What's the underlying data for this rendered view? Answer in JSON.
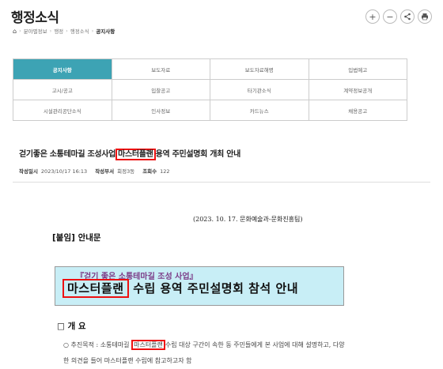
{
  "header": {
    "title": "행정소식"
  },
  "toolbar": {
    "zoom_in_label": "+",
    "zoom_out_label": "−"
  },
  "breadcrumb": {
    "items": [
      "분야별정보",
      "행정",
      "행정소식"
    ],
    "current": "공지사항"
  },
  "tabs": [
    {
      "label": "공지사항",
      "active": true
    },
    {
      "label": "보도자료",
      "active": false
    },
    {
      "label": "보도자료해명",
      "active": false
    },
    {
      "label": "입법예고",
      "active": false
    },
    {
      "label": "고시/공고",
      "active": false
    },
    {
      "label": "입찰공고",
      "active": false
    },
    {
      "label": "타기관소식",
      "active": false
    },
    {
      "label": "계약정보공개",
      "active": false
    },
    {
      "label": "시설관리공단소식",
      "active": false
    },
    {
      "label": "인사정보",
      "active": false
    },
    {
      "label": "카드뉴스",
      "active": false
    },
    {
      "label": "채용공고",
      "active": false
    }
  ],
  "post": {
    "title_pre": "걷기좋은 소통테마길 조성사업",
    "title_hl": "마스터플랜",
    "title_post": "용역 주민설명회 개최 안내",
    "meta": {
      "date_label": "작성일시",
      "date": "2023/10/17 16:13",
      "author_label": "작성부서",
      "author": "회정3동",
      "views_label": "조회수",
      "views": "122"
    }
  },
  "doc": {
    "date_line": "(2023. 10. 17. 문화예술과-문화진흥팀)",
    "attach_title": "[붙임] 안내문",
    "banner_sub": "『걷기 좋은 소통테마길 조성 사업』",
    "banner_hl": "마스터플랜",
    "banner_rest": " 수립 용역 주민설명회 참석 안내",
    "section_title": "□ 개    요",
    "para_pre": "○ 추진목적 : 소통테마길",
    "para_hl": "마스터플랜",
    "para_post": "수립 대상 구간이 속한 동 주민들에게 본 사업에 대해 설명하고, 다양한 의견을 들어 마스터플랜 수립에 참고하고자 함"
  },
  "colors": {
    "accent": "#3da3b4",
    "highlight_box": "#e11111",
    "banner_bg": "#c8eef6"
  }
}
